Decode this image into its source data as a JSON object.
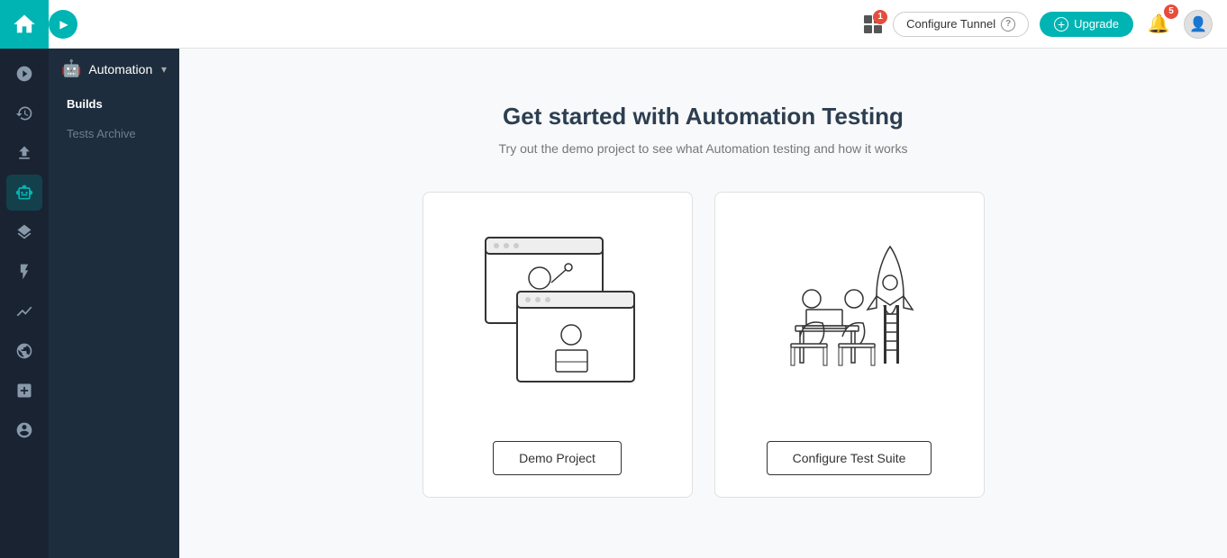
{
  "header": {
    "home_icon": "home",
    "grid_badge": "1",
    "configure_tunnel_label": "Configure Tunnel",
    "help_label": "?",
    "upgrade_label": "Upgrade",
    "notification_badge": "5"
  },
  "sidebar": {
    "narrow_icons": [
      {
        "name": "analytics-icon",
        "symbol": "◎"
      },
      {
        "name": "history-icon",
        "symbol": "⏱"
      },
      {
        "name": "upload-icon",
        "symbol": "⬆"
      },
      {
        "name": "automation-icon",
        "symbol": "🤖"
      },
      {
        "name": "layers-icon",
        "symbol": "▣"
      },
      {
        "name": "lightning-icon",
        "symbol": "⚡"
      },
      {
        "name": "chart-icon",
        "symbol": "↗"
      },
      {
        "name": "integration-icon",
        "symbol": "◎"
      },
      {
        "name": "add-icon",
        "symbol": "+"
      },
      {
        "name": "settings-icon",
        "symbol": "⚙"
      }
    ],
    "automation_section": {
      "label": "Automation",
      "items": [
        {
          "label": "Builds",
          "active": true
        },
        {
          "label": "Tests Archive",
          "muted": true
        }
      ]
    }
  },
  "main": {
    "title": "Get started with Automation Testing",
    "subtitle": "Try out the demo project to see what Automation testing and how it works",
    "cards": [
      {
        "id": "demo-project",
        "button_label": "Demo Project"
      },
      {
        "id": "configure-test-suite",
        "button_label": "Configure Test Suite"
      }
    ]
  }
}
